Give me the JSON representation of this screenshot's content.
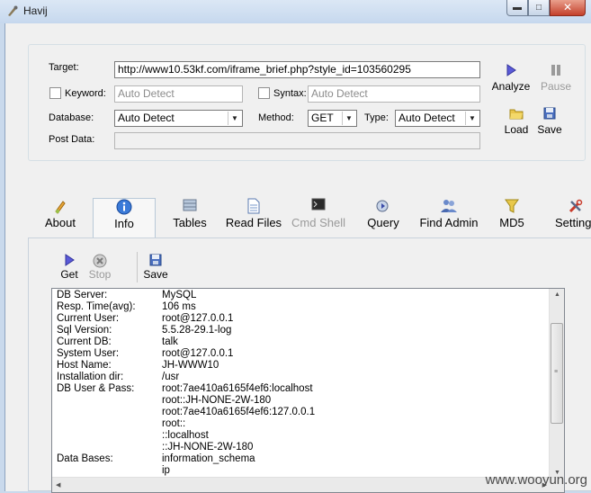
{
  "window": {
    "title": "Havij"
  },
  "form": {
    "target_label": "Target:",
    "target_value": "http://www10.53kf.com/iframe_brief.php?style_id=103560295",
    "keyword_label": "Keyword:",
    "keyword_placeholder": "Auto Detect",
    "syntax_label": "Syntax:",
    "syntax_placeholder": "Auto Detect",
    "database_label": "Database:",
    "database_value": "Auto Detect",
    "method_label": "Method:",
    "method_value": "GET",
    "type_label": "Type:",
    "type_value": "Auto Detect",
    "postdata_label": "Post Data:"
  },
  "side_buttons": {
    "analyze": "Analyze",
    "pause": "Pause",
    "load": "Load",
    "save": "Save"
  },
  "tabs": [
    "About",
    "Info",
    "Tables",
    "Read Files",
    "Cmd Shell",
    "Query",
    "Find Admin",
    "MD5",
    "Settings"
  ],
  "toolbar": {
    "get": "Get",
    "stop": "Stop",
    "save": "Save"
  },
  "output": [
    {
      "key": "DB Server:",
      "value": "MySQL"
    },
    {
      "key": "Resp. Time(avg):",
      "value": "106 ms"
    },
    {
      "key": "Current User:",
      "value": "root@127.0.0.1"
    },
    {
      "key": "Sql Version:",
      "value": "5.5.28-29.1-log"
    },
    {
      "key": "Current DB:",
      "value": "talk"
    },
    {
      "key": "System User:",
      "value": "root@127.0.0.1"
    },
    {
      "key": "Host Name:",
      "value": "JH-WWW10"
    },
    {
      "key": "Installation dir:",
      "value": "/usr"
    },
    {
      "key": "DB User & Pass:",
      "value": "root:7ae410a6165f4ef6:localhost"
    },
    {
      "key": "",
      "value": "root::JH-NONE-2W-180"
    },
    {
      "key": "",
      "value": "root:7ae410a6165f4ef6:127.0.0.1"
    },
    {
      "key": "",
      "value": "root::"
    },
    {
      "key": "",
      "value": "::localhost"
    },
    {
      "key": "",
      "value": "::JH-NONE-2W-180"
    },
    {
      "key": "Data Bases:",
      "value": "information_schema"
    },
    {
      "key": "",
      "value": "ip"
    }
  ],
  "watermark": "www.wooyun.org",
  "colors": {
    "accent": "#5a5ad8",
    "disabled_text": "#9a9a9a"
  }
}
